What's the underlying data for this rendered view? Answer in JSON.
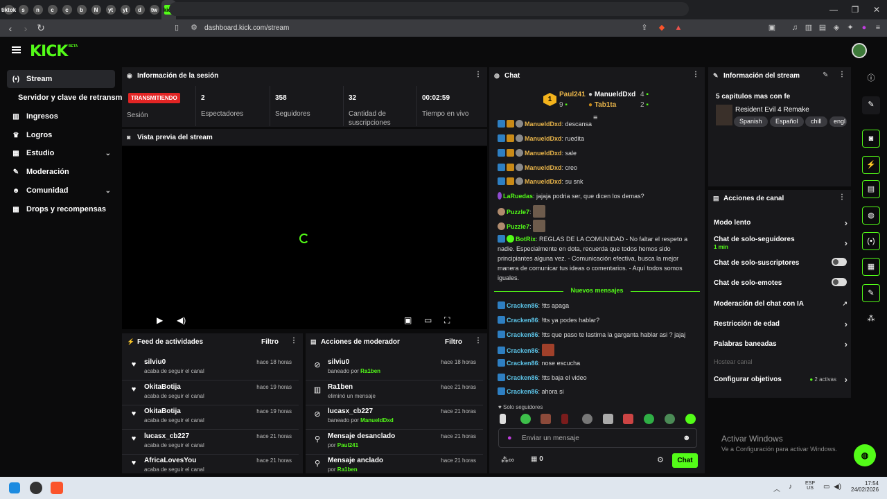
{
  "browser": {
    "tabs": [
      "tiktok",
      "s",
      "n",
      "c",
      "c",
      "b",
      "N",
      "yt",
      "yt",
      "d",
      "tw",
      "kick"
    ],
    "new_tab": "+",
    "url": "dashboard.kick.com/stream",
    "window_controls": [
      "—",
      "❐",
      "✕"
    ]
  },
  "header": {
    "logo": "KICK",
    "logo_beta": "BETA"
  },
  "sidebar": {
    "items": [
      {
        "label": "Stream",
        "icon": "broadcast-icon",
        "selected": true
      },
      {
        "label": "Servidor y clave de retransm",
        "icon": "",
        "selected": false
      },
      {
        "label": "Ingresos",
        "icon": "chart-icon"
      },
      {
        "label": "Logros",
        "icon": "trophy-icon"
      },
      {
        "label": "Estudio",
        "icon": "grid-icon",
        "chevron": true
      },
      {
        "label": "Moderación",
        "icon": "wrench-icon"
      },
      {
        "label": "Comunidad",
        "icon": "people-icon",
        "chevron": true
      },
      {
        "label": "Drops y recompensas",
        "icon": "gift-icon"
      }
    ]
  },
  "session": {
    "title": "Información de la sesión",
    "badge": "TRANSMITIENDO",
    "stats": [
      {
        "value": "",
        "label": "Sesión"
      },
      {
        "value": "2",
        "label": "Espectadores"
      },
      {
        "value": "358",
        "label": "Seguidores"
      },
      {
        "value": "32",
        "label": "Cantidad de suscripciones"
      },
      {
        "value": "00:02:59",
        "label": "Tiempo en vivo"
      }
    ]
  },
  "preview": {
    "title": "Vista previa del stream"
  },
  "activity": {
    "title": "Feed de actividades",
    "filter": "Filtro",
    "items": [
      {
        "name": "silviu0",
        "sub": "acaba de seguir el canal",
        "time": "hace 18 horas"
      },
      {
        "name": "OkitaBotija",
        "sub": "acaba de seguir el canal",
        "time": "hace 19 horas"
      },
      {
        "name": "OkitaBotija",
        "sub": "acaba de seguir el canal",
        "time": "hace 19 horas"
      },
      {
        "name": "lucasx_cb227",
        "sub": "acaba de seguir el canal",
        "time": "hace 21 horas"
      },
      {
        "name": "AfricaLovesYou",
        "sub": "acaba de seguir el canal",
        "time": "hace 21 horas"
      }
    ]
  },
  "modactions": {
    "title": "Acciones de moderador",
    "filter": "Filtro",
    "items": [
      {
        "name": "silviu0",
        "sub": "baneado por",
        "by": "Ra1ben",
        "time": "hace 18 horas"
      },
      {
        "name": "Ra1ben",
        "sub": "eliminó un mensaje",
        "by": "",
        "time": "hace 21 horas"
      },
      {
        "name": "lucasx_cb227",
        "sub": "baneado por",
        "by": "ManueldDxd",
        "time": "hace 21 horas"
      },
      {
        "name": "Mensaje desanclado",
        "sub": "por",
        "by": "Paul241",
        "time": "hace 21 horas"
      },
      {
        "name": "Mensaje anclado",
        "sub": "por",
        "by": "Ra1ben",
        "time": "hace 21 horas"
      }
    ]
  },
  "chat": {
    "title": "Chat",
    "top": {
      "rank": "1",
      "first_name": "Paul241",
      "first_count": "9",
      "second_name": "ManueldDxd",
      "second_count": "4",
      "third_name": "Tab1ta",
      "third_count": "2"
    },
    "messages": [
      {
        "user": "ManueldDxd",
        "text": ": descansa"
      },
      {
        "user": "ManueldDxd",
        "text": ": ruedita"
      },
      {
        "user": "ManueldDxd",
        "text": ": sale"
      },
      {
        "user": "ManueldDxd",
        "text": ": creo"
      },
      {
        "user": "ManueldDxd",
        "text": ": su snk"
      },
      {
        "user": "LaRuedas",
        "text": ": jajaja podria ser, que dicen los demas?"
      },
      {
        "user": "Puzzle7",
        "text": ":"
      },
      {
        "user": "Puzzle7",
        "text": ":"
      },
      {
        "user": "BotRix",
        "text": ": REGLAS DE LA COMUNIDAD - No faltar el respeto a nadie. Especialmente en dota, recuerda que todos hemos sido principiantes alguna vez. - Comunicación efectiva, busca la mejor manera de comunicar tus ideas o comentarios. - Aquí todos somos iguales."
      }
    ],
    "new_divider": "Nuevos mensajes",
    "new_messages": [
      {
        "user": "Cracken86",
        "text": ": !tts apaga"
      },
      {
        "user": "Cracken86",
        "text": ": !tts ya podes hablar?"
      },
      {
        "user": "Cracken86",
        "text": ": !tts que paso te lastima la garganta hablar asi ? jajaj"
      },
      {
        "user": "Cracken86",
        "text": ":"
      },
      {
        "user": "Cracken86",
        "text": ": nose escucha"
      },
      {
        "user": "Cracken86",
        "text": ": !tts baja el video"
      },
      {
        "user": "Cracken86",
        "text": ": ahora si"
      }
    ],
    "mode": "Solo seguidores",
    "placeholder": "Enviar un mensaje",
    "points": "0",
    "send": "Chat"
  },
  "stream_info": {
    "title": "Información del stream",
    "stream_title": "5 capitulos mas con fe",
    "category": "Resident Evil 4 Remake",
    "tags": [
      "Spanish",
      "Español",
      "chill",
      "engl"
    ]
  },
  "channel_actions": {
    "title": "Acciones de canal",
    "items": [
      {
        "label": "Modo lento",
        "control": "arrow"
      },
      {
        "label": "Chat de solo-seguidores",
        "sub": "1 min",
        "control": "arrow"
      },
      {
        "label": "Chat de solo-suscriptores",
        "control": "toggle"
      },
      {
        "label": "Chat de solo-emotes",
        "control": "toggle"
      },
      {
        "label": "Moderación del chat con IA",
        "control": "external"
      },
      {
        "label": "Restricción de edad",
        "control": "arrow"
      },
      {
        "label": "Palabras baneadas",
        "control": "arrow"
      },
      {
        "label": "Hostear canal",
        "control": "none",
        "disabled": true
      },
      {
        "label": "Configurar objetivos",
        "extra": "2 activas",
        "control": "arrow"
      }
    ]
  },
  "watermark": {
    "line1": "Activar Windows",
    "line2": "Ve a Configuración para activar Windows."
  },
  "taskbar": {
    "lang1": "ESP",
    "lang2": "US",
    "time": "17:54",
    "date": "24/02/2026"
  },
  "colors": {
    "accent": "#53fc18",
    "panel": "#18181b",
    "live": "#e22424"
  }
}
